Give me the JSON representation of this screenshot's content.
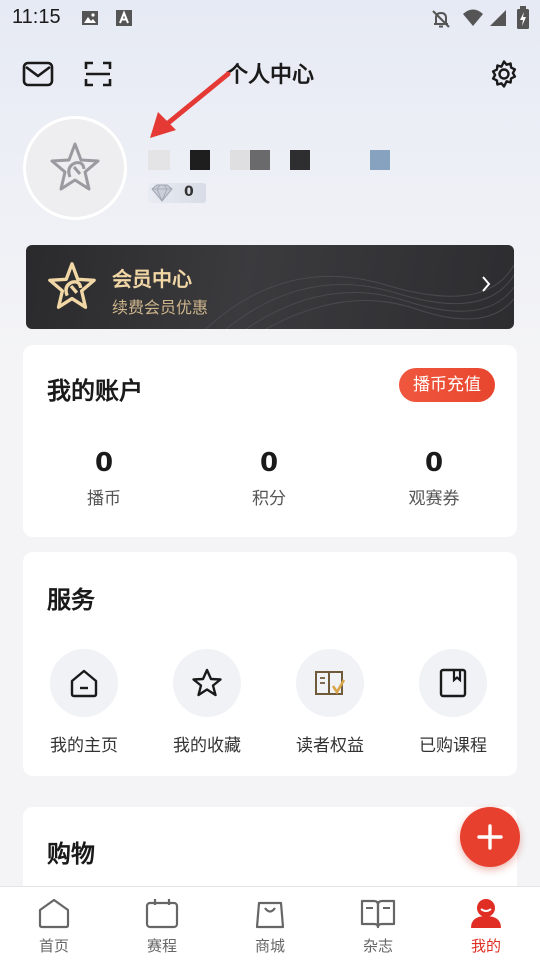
{
  "status_bar": {
    "time": "11:15"
  },
  "header": {
    "title": "个人中心"
  },
  "profile": {
    "level_count": "0"
  },
  "vip": {
    "title": "会员中心",
    "subtitle": "续费会员优惠"
  },
  "account": {
    "title": "我的账户",
    "recharge_label": "播币充值",
    "stats": [
      {
        "value": "0",
        "label": "播币"
      },
      {
        "value": "0",
        "label": "积分"
      },
      {
        "value": "0",
        "label": "观赛券"
      }
    ]
  },
  "services": {
    "title": "服务",
    "items": [
      {
        "label": "我的主页",
        "icon": "home-icon"
      },
      {
        "label": "我的收藏",
        "icon": "star-icon"
      },
      {
        "label": "读者权益",
        "icon": "reader-rights-icon"
      },
      {
        "label": "已购课程",
        "icon": "purchased-course-icon"
      }
    ]
  },
  "shopping": {
    "title": "购物"
  },
  "bottom_nav": {
    "items": [
      {
        "label": "首页",
        "icon": "home-icon"
      },
      {
        "label": "赛程",
        "icon": "calendar-icon"
      },
      {
        "label": "商城",
        "icon": "shopping-bag-icon"
      },
      {
        "label": "杂志",
        "icon": "book-icon"
      },
      {
        "label": "我的",
        "icon": "profile-icon"
      }
    ],
    "active_index": 4
  },
  "colors": {
    "accent": "#e02e24",
    "recharge": "#ee5038",
    "vip_gold": "#f2d7a6",
    "arrow": "#e53935"
  }
}
